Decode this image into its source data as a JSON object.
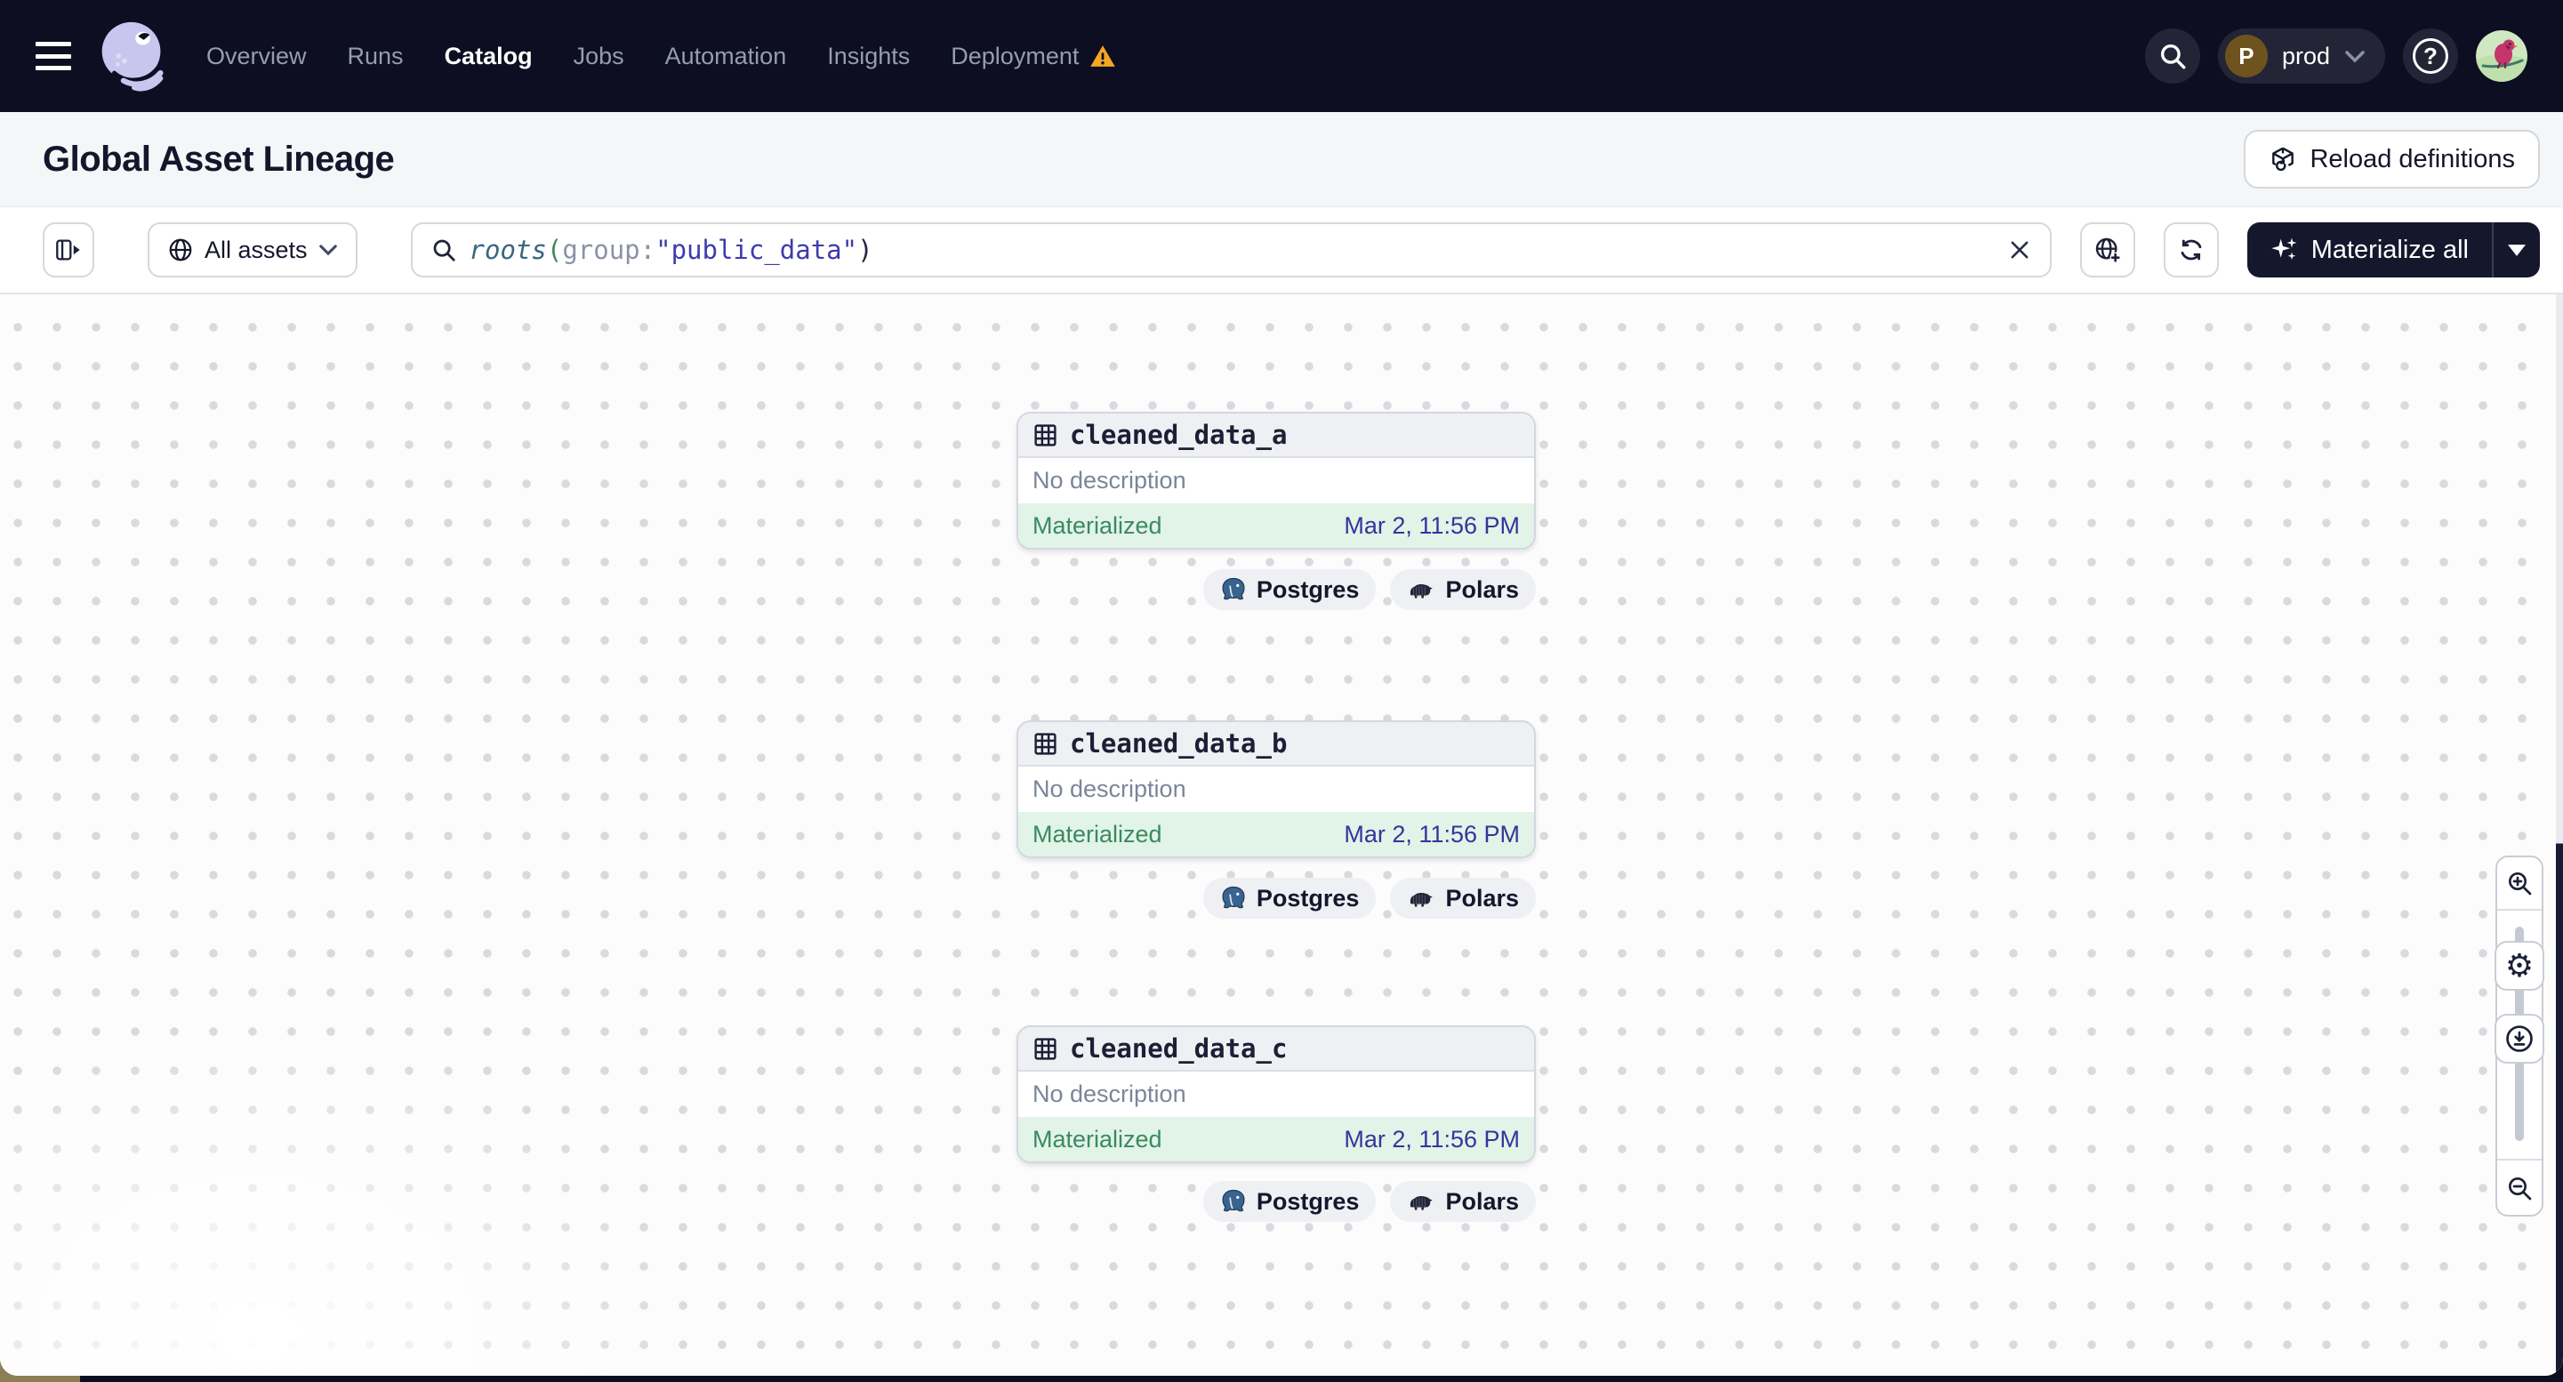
{
  "navbar": {
    "items": [
      {
        "label": "Overview"
      },
      {
        "label": "Runs"
      },
      {
        "label": "Catalog",
        "active": true
      },
      {
        "label": "Jobs"
      },
      {
        "label": "Automation"
      },
      {
        "label": "Insights"
      },
      {
        "label": "Deployment",
        "warning": true
      }
    ],
    "environment": {
      "initial": "P",
      "name": "prod"
    },
    "help_glyph": "?"
  },
  "header": {
    "title": "Global Asset Lineage",
    "reload_label": "Reload definitions"
  },
  "toolbar": {
    "assets_filter_label": "All assets",
    "materialize_label": "Materialize all",
    "query_segments": [
      {
        "text": "roots",
        "color": "#3a6680"
      },
      {
        "text": "(",
        "color": "#3f8a5a"
      },
      {
        "text": "group",
        "color": "#8a93a6"
      },
      {
        "text": ":",
        "color": "#8a93a6"
      },
      {
        "text": "\"public_data\"",
        "color": "#3d3bae"
      },
      {
        "text": ")",
        "color": "#232741"
      }
    ]
  },
  "canvas": {
    "nodes": [
      {
        "name": "cleaned_data_a",
        "description": "No description",
        "status": "Materialized",
        "materialized_at": "Mar 2, 11:56 PM",
        "tags": [
          "Postgres",
          "Polars"
        ]
      },
      {
        "name": "cleaned_data_b",
        "description": "No description",
        "status": "Materialized",
        "materialized_at": "Mar 2, 11:56 PM",
        "tags": [
          "Postgres",
          "Polars"
        ]
      },
      {
        "name": "cleaned_data_c",
        "description": "No description",
        "status": "Materialized",
        "materialized_at": "Mar 2, 11:56 PM",
        "tags": [
          "Postgres",
          "Polars"
        ]
      }
    ]
  },
  "colors": {
    "nav_bg": "#0d0e21",
    "accent_warning": "#f5a623",
    "status_green_bg": "#e2f3e8",
    "status_green_text": "#3a8a5f",
    "timestamp_blue": "#37349b",
    "materialize_bg": "#15172d"
  },
  "icons": {
    "gear": "⚙"
  }
}
